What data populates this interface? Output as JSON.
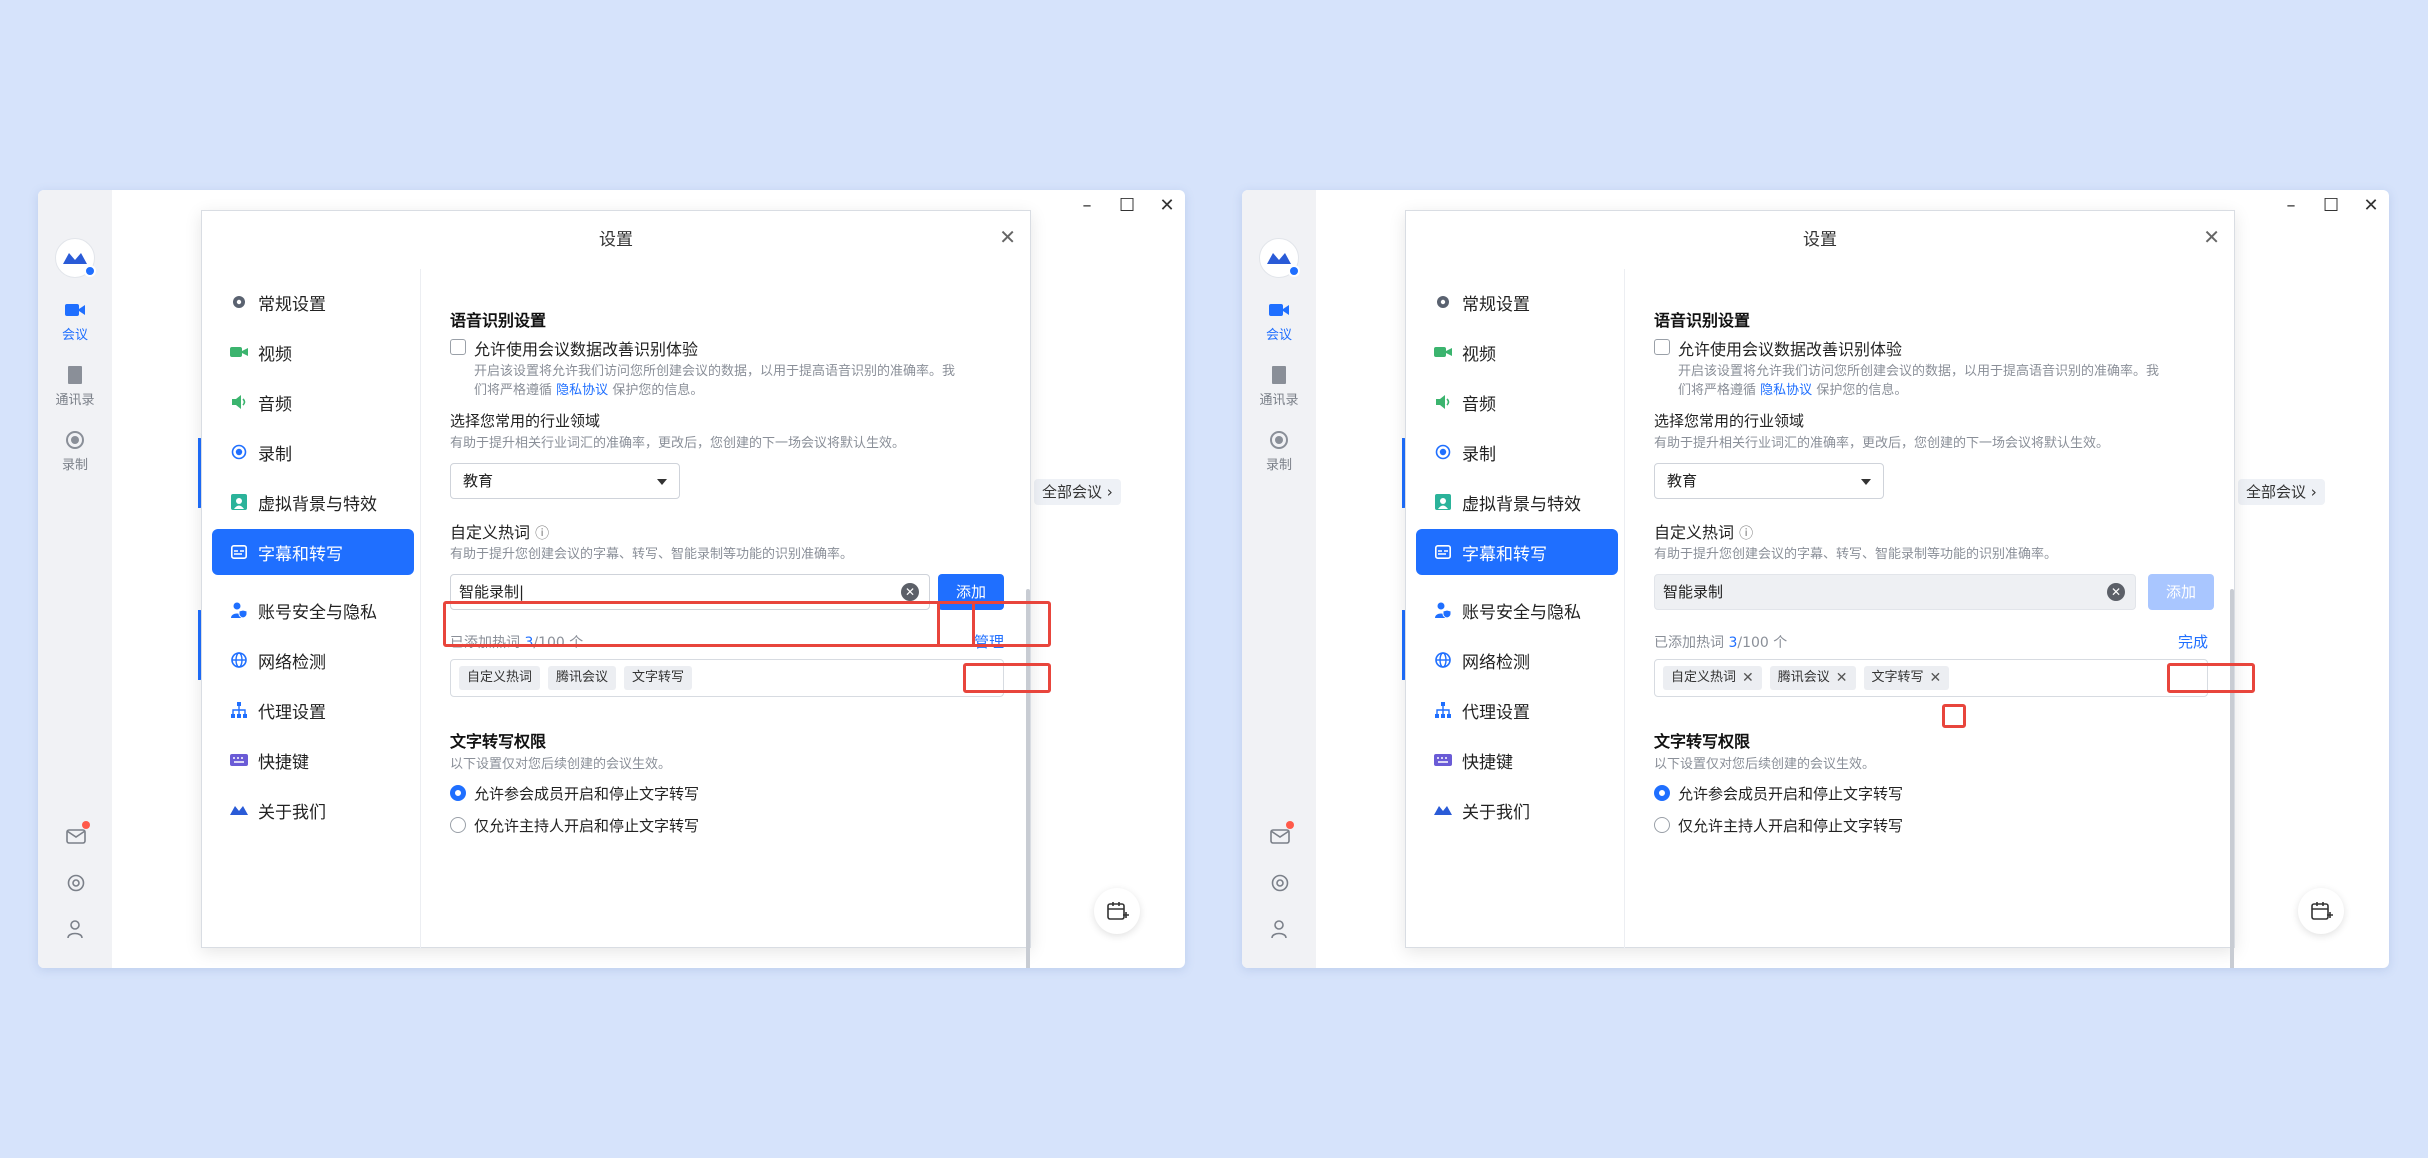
{
  "rail": {
    "items": [
      {
        "label": "会议",
        "icon": "video-icon"
      },
      {
        "label": "通讯录",
        "icon": "contacts-icon"
      },
      {
        "label": "录制",
        "icon": "record-icon"
      }
    ]
  },
  "main": {
    "all_meetings": "全部会议"
  },
  "dialog": {
    "title": "设置",
    "nav": [
      {
        "label": "常规设置",
        "icon": "gear-icon"
      },
      {
        "label": "视频",
        "icon": "video-icon"
      },
      {
        "label": "音频",
        "icon": "speaker-icon"
      },
      {
        "label": "录制",
        "icon": "record-icon"
      },
      {
        "label": "虚拟背景与特效",
        "icon": "background-icon"
      },
      {
        "label": "字幕和转写",
        "icon": "caption-icon"
      },
      {
        "label": "账号安全与隐私",
        "icon": "account-security-icon"
      },
      {
        "label": "网络检测",
        "icon": "globe-icon"
      },
      {
        "label": "代理设置",
        "icon": "proxy-icon"
      },
      {
        "label": "快捷键",
        "icon": "keyboard-icon"
      },
      {
        "label": "关于我们",
        "icon": "brand-logo-icon"
      }
    ],
    "speech": {
      "title": "语音识别设置",
      "checkbox_label": "允许使用会议数据改善识别体验",
      "desc_line1": "开启该设置将允许我们访问您所创建会议的数据，以用于提高语音识别的准确率。我",
      "desc_line2_pre": "们将严格遵循",
      "privacy_link": "隐私协议",
      "desc_line2_post": "保护您的信息。"
    },
    "industry": {
      "label": "选择您常用的行业领域",
      "hint": "有助于提升相关行业词汇的准确率，更改后，您创建的下一场会议将默认生效。",
      "selected": "教育"
    },
    "hotwords": {
      "label": "自定义热词",
      "hint": "有助于提升您创建会议的字幕、转写、智能录制等功能的识别准确率。",
      "input_value": "智能录制",
      "add_button": "添加",
      "count_prefix": "已添加热词",
      "count_current": "3",
      "count_total": "/100 个",
      "manage_label": "管理",
      "done_label": "完成",
      "tags": [
        "自定义热词",
        "腾讯会议",
        "文字转写"
      ]
    },
    "transcribe": {
      "title": "文字转写权限",
      "hint": "以下设置仅对您后续创建的会议生效。",
      "option1": "允许参会成员开启和停止文字转写",
      "option2": "仅允许主持人开启和停止文字转写"
    }
  },
  "colors": {
    "accent": "#1f6fff",
    "highlight": "#e8453c",
    "background": "#d6e3fb"
  }
}
